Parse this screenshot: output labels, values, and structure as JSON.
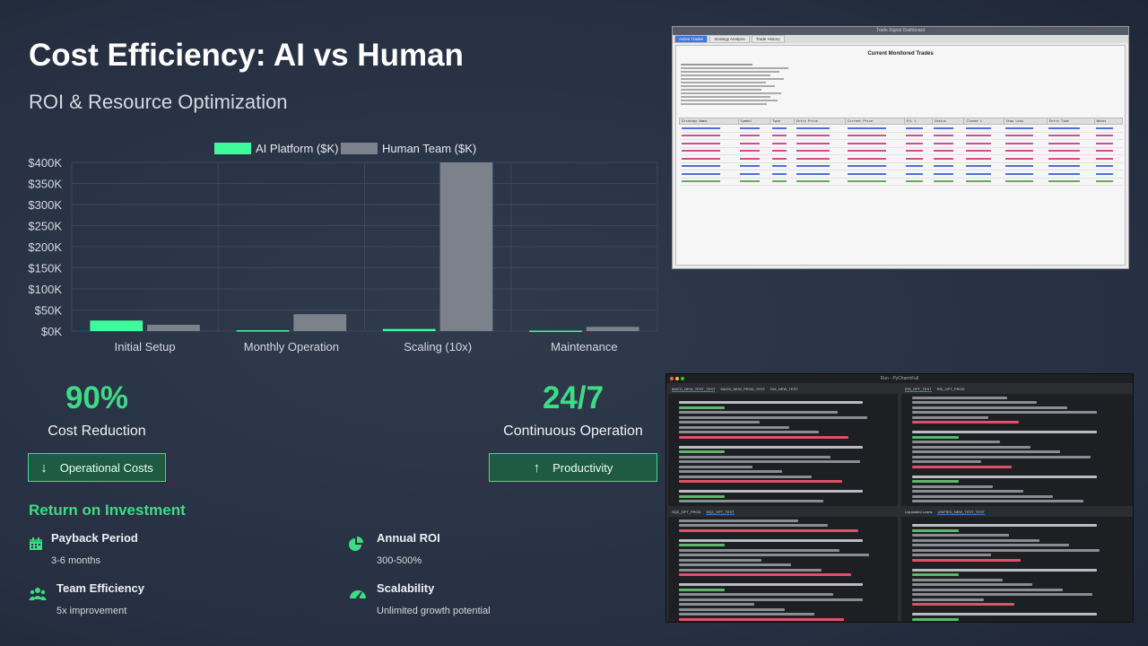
{
  "slide": {
    "title": "Cost Efficiency: AI vs Human",
    "subtitle": "ROI & Resource Optimization"
  },
  "chart_data": {
    "type": "bar",
    "categories": [
      "Initial Setup",
      "Monthly Operation",
      "Scaling (10x)",
      "Maintenance"
    ],
    "series": [
      {
        "name": "AI Platform ($K)",
        "values": [
          25,
          2,
          5,
          1
        ],
        "color": "#3dfc9c"
      },
      {
        "name": "Human Team ($K)",
        "values": [
          15,
          40,
          400,
          10
        ],
        "color": "#7c828c"
      }
    ],
    "y_ticks": [
      "$0K",
      "$50K",
      "$100K",
      "$150K",
      "$200K",
      "$250K",
      "$300K",
      "$350K",
      "$400K"
    ],
    "ylim": [
      0,
      400
    ],
    "legend": "top-center",
    "grid": true
  },
  "metrics": [
    {
      "value": "90%",
      "label": "Cost Reduction",
      "button": "Operational Costs",
      "button_icon": "arrow-down-icon"
    },
    {
      "value": "24/7",
      "label": "Continuous Operation",
      "button": "Productivity",
      "button_icon": "arrow-up-icon"
    }
  ],
  "roi": {
    "title": "Return on Investment",
    "items": [
      {
        "heading": "Payback Period",
        "text": "3-6 months",
        "icon": "calendar-icon"
      },
      {
        "heading": "Annual ROI",
        "text": "300-500%",
        "icon": "pie-chart-icon"
      },
      {
        "heading": "Team Efficiency",
        "text": "5x improvement",
        "icon": "users-icon"
      },
      {
        "heading": "Scalability",
        "text": "Unlimited growth potential",
        "icon": "gauge-icon"
      }
    ]
  },
  "screenshot1": {
    "window_title": "Trade Signal Dashboard",
    "tabs": [
      "Active Trades",
      "Strategy Analysis",
      "Trade History"
    ],
    "heading": "Current Monitored Trades",
    "columns": [
      "Strategy Name",
      "Symbol",
      "Type",
      "Entry Price",
      "Current Price",
      "P/L %",
      "Status",
      "Closed %",
      "Stop Loss",
      "Entry Time",
      "Notes"
    ]
  },
  "screenshot2": {
    "window_title": "Run - PyCharmFull",
    "tabs_top_left": [
      "MACO_NEW_TEST_TEST",
      "MACD_NEW_PROD_TEST",
      "DIX_NEW_TEST"
    ],
    "tabs_top_right": [
      "RSI_OPT_TEST",
      "RSI_OPT_PROD"
    ],
    "tabs_bottom_left": [
      "SQZ_OPT_PROD",
      "SQZ_OPT_TEST"
    ],
    "tabs_bottom_right": [
      "Liquidated.Leans",
      "UNIFIED_NEW_TEST_TEST"
    ]
  },
  "colors": {
    "accent": "#3ddc84",
    "human": "#7c828c",
    "ai": "#3dfc9c"
  }
}
